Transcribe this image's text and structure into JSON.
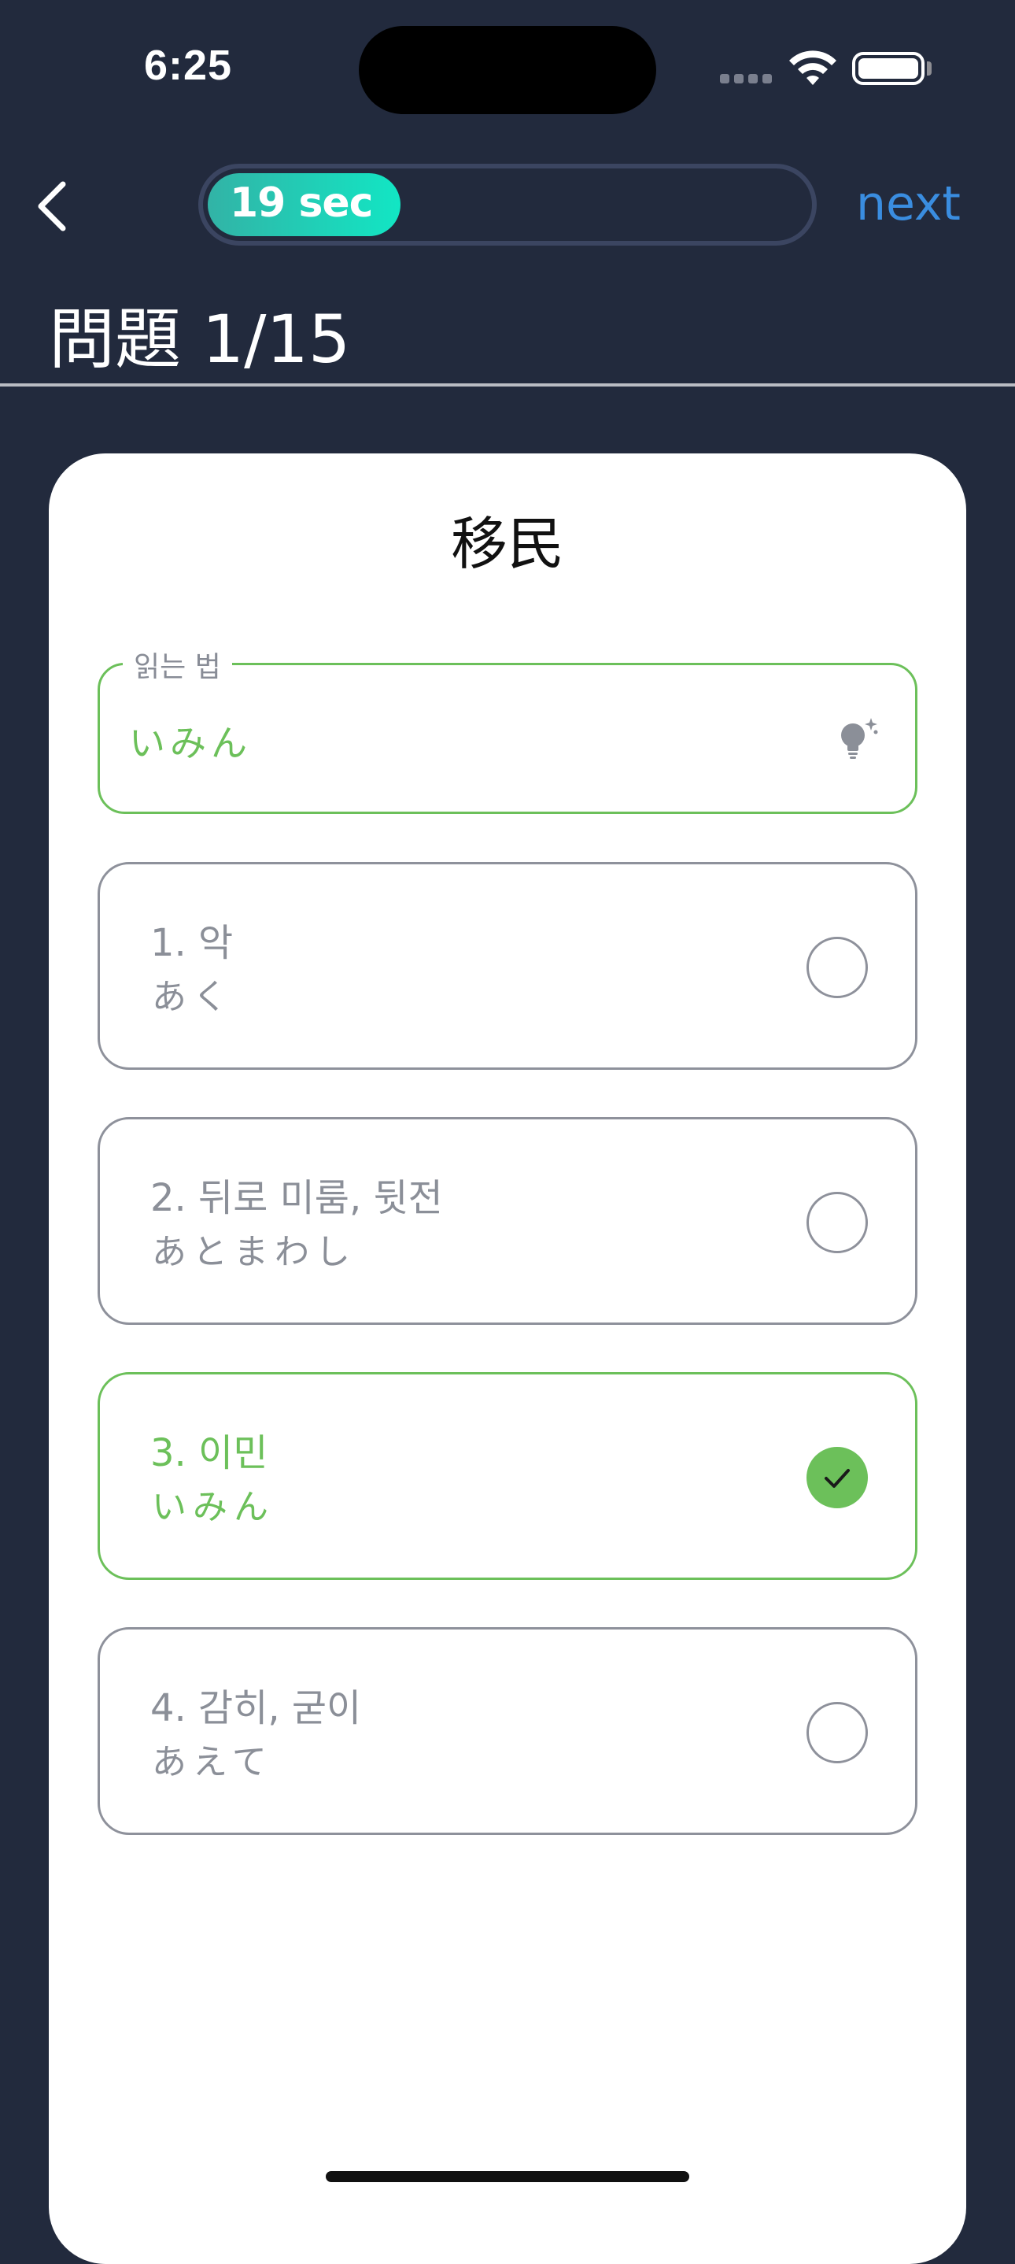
{
  "status_bar": {
    "time": "6:25"
  },
  "header": {
    "timer_label": "19 sec",
    "timer_remaining_fraction": 0.18,
    "next_label": "next"
  },
  "question": {
    "title": "問題 1/15",
    "word": "移民"
  },
  "reading": {
    "legend": "읽는 법",
    "value": "いみん"
  },
  "options": [
    {
      "main": "1. 악",
      "sub": "あく",
      "selected": false
    },
    {
      "main": "2. 뒤로 미룸, 뒷전",
      "sub": "あとまわし",
      "selected": false
    },
    {
      "main": "3. 이민",
      "sub": "いみん",
      "selected": true
    },
    {
      "main": "4. 감히, 굳이",
      "sub": "あえて",
      "selected": false
    }
  ],
  "colors": {
    "background": "#222a3d",
    "accent_green": "#6cc05a",
    "timer_gradient_start": "#32b3a6",
    "timer_gradient_end": "#12e6c4",
    "next_blue": "#3a8de0"
  }
}
